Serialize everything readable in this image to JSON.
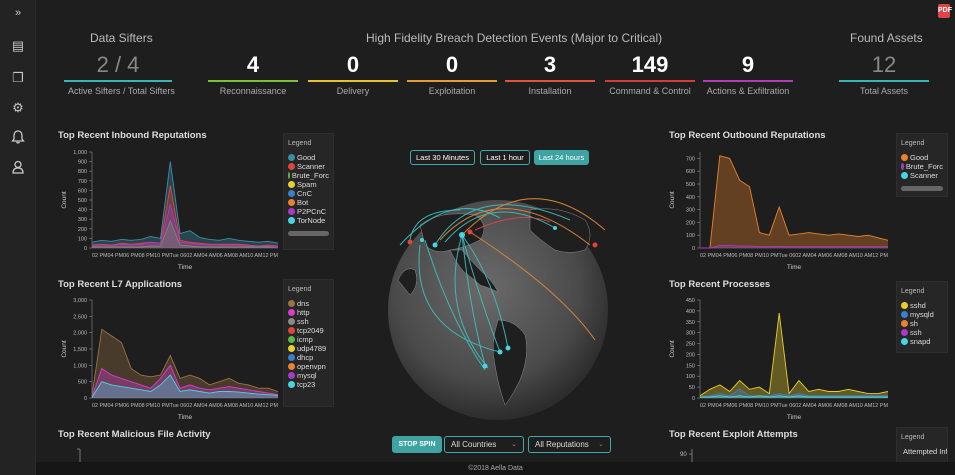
{
  "sidebar": {
    "items": [
      {
        "icon": "expand-chevrons-icon",
        "glyph": "»"
      },
      {
        "icon": "dashboard-card-icon",
        "glyph": "▤"
      },
      {
        "icon": "documents-icon",
        "glyph": "❐"
      },
      {
        "icon": "settings-gears-icon",
        "glyph": "⚙"
      },
      {
        "icon": "bell-icon",
        "glyph": "♫"
      },
      {
        "icon": "user-icon",
        "glyph": "⚇"
      }
    ]
  },
  "header": {
    "data_sifters_title": "Data Sifters",
    "breach_title": "High Fidelity Breach Detection Events (Major to Critical)",
    "found_assets_title": "Found Assets",
    "pdf_label": "PDF"
  },
  "kpis": [
    {
      "value": "2 / 4",
      "label": "Active Sifters / Total Sifters",
      "color": "#3ab5b5"
    },
    {
      "value": "4",
      "label": "Reconnaissance",
      "color": "#7bbf3a"
    },
    {
      "value": "0",
      "label": "Delivery",
      "color": "#e6c232"
    },
    {
      "value": "0",
      "label": "Exploitation",
      "color": "#e89b2e"
    },
    {
      "value": "3",
      "label": "Installation",
      "color": "#e0553a"
    },
    {
      "value": "149",
      "label": "Command & Control",
      "color": "#d43c3c"
    },
    {
      "value": "9",
      "label": "Actions & Exfiltration",
      "color": "#b23cb8"
    },
    {
      "value": "12",
      "label": "Total Assets",
      "color": "#3ab5b5"
    }
  ],
  "panels": {
    "inbound": {
      "title": "Top Recent Inbound Reputations"
    },
    "l7": {
      "title": "Top Recent L7 Applications"
    },
    "malicious": {
      "title": "Top Recent Malicious File Activity"
    },
    "outbound": {
      "title": "Top Recent Outbound Reputations"
    },
    "processes": {
      "title": "Top Recent Processes"
    },
    "exploits": {
      "title": "Top Recent Exploit Attempts"
    }
  },
  "legend_title": "Legend",
  "legends": {
    "inbound": [
      {
        "label": "Good",
        "color": "#3a8fa8"
      },
      {
        "label": "Scanner",
        "color": "#e0453a"
      },
      {
        "label": "Brute_Forc",
        "color": "#5ab84a"
      },
      {
        "label": "Spam",
        "color": "#e8cf2e"
      },
      {
        "label": "CnC",
        "color": "#3a7ed0"
      },
      {
        "label": "Bot",
        "color": "#e8822e"
      },
      {
        "label": "P2PCnC",
        "color": "#a73ac8"
      },
      {
        "label": "TorNode",
        "color": "#46d6e0"
      }
    ],
    "l7": [
      {
        "label": "dns",
        "color": "#9a7344"
      },
      {
        "label": "http",
        "color": "#d83cd0"
      },
      {
        "label": "ssh",
        "color": "#8a8a8a"
      },
      {
        "label": "tcp2049",
        "color": "#e0453a"
      },
      {
        "label": "icmp",
        "color": "#5ab84a"
      },
      {
        "label": "udp4789",
        "color": "#e8cf2e"
      },
      {
        "label": "dhcp",
        "color": "#3a7ed0"
      },
      {
        "label": "openvpn",
        "color": "#e8822e"
      },
      {
        "label": "mysql",
        "color": "#a73ac8"
      },
      {
        "label": "tcp23",
        "color": "#46d6e0"
      }
    ],
    "outbound": [
      {
        "label": "Good",
        "color": "#e8822e"
      },
      {
        "label": "Brute_Forc",
        "color": "#a73ac8"
      },
      {
        "label": "Scanner",
        "color": "#46d6e0"
      }
    ],
    "processes": [
      {
        "label": "sshd",
        "color": "#e8cf2e"
      },
      {
        "label": "mysqld",
        "color": "#3a7ed0"
      },
      {
        "label": "sh",
        "color": "#e8822e"
      },
      {
        "label": "ssh",
        "color": "#a73ac8"
      },
      {
        "label": "snapd",
        "color": "#46d6e0"
      }
    ],
    "exploits": [
      {
        "label": "Attempted Informatior Leak",
        "color": "#a73ac8"
      }
    ]
  },
  "time_buttons": [
    "Last 30 Minutes",
    "Last 1 hour",
    "Last 24 hours"
  ],
  "controls": {
    "stop_spin": "STOP SPIN",
    "countries": "All Countries",
    "reputations": "All Reputations"
  },
  "footer": "©2018 Aella Data",
  "axis": {
    "count": "Count",
    "time": "Time"
  },
  "x_ticks": "02 PM04 PM06 PM08 PM10 PMTue 0602 AM04 AM06 AM08 AM10 AM12 PM",
  "chart_data": [
    {
      "type": "area",
      "title": "Top Recent Inbound Reputations",
      "ylabel": "Count",
      "xlabel": "Time",
      "ylim": [
        0,
        1000
      ],
      "y_ticks": [
        "1,000",
        "900",
        "800",
        "700",
        "600",
        "500",
        "400",
        "300",
        "200",
        "100",
        "0"
      ],
      "series": [
        {
          "name": "Good",
          "values": [
            60,
            80,
            70,
            90,
            80,
            90,
            120,
            100,
            900,
            150,
            180,
            110,
            90,
            80,
            100,
            80,
            70,
            60,
            70,
            50
          ]
        },
        {
          "name": "Scanner",
          "values": [
            30,
            40,
            30,
            50,
            40,
            50,
            60,
            50,
            650,
            80,
            60,
            50,
            40,
            40,
            40,
            40,
            30,
            20,
            30,
            20
          ]
        },
        {
          "name": "Brute_Forc",
          "values": [
            10,
            10,
            10,
            10,
            10,
            10,
            20,
            20,
            280,
            30,
            20,
            10,
            10,
            10,
            10,
            10,
            10,
            10,
            10,
            10
          ]
        },
        {
          "name": "P2PCnC",
          "values": [
            20,
            30,
            20,
            40,
            30,
            40,
            60,
            50,
            450,
            60,
            50,
            40,
            30,
            30,
            30,
            30,
            20,
            20,
            20,
            10
          ]
        }
      ]
    },
    {
      "type": "area",
      "title": "Top Recent L7 Applications",
      "ylabel": "Count",
      "xlabel": "Time",
      "ylim": [
        0,
        3000
      ],
      "y_ticks": [
        "3,000",
        "2,500",
        "2,000",
        "1,500",
        "1,000",
        "500",
        "0"
      ],
      "series": [
        {
          "name": "dns",
          "values": [
            80,
            2100,
            1900,
            1700,
            900,
            700,
            650,
            700,
            1300,
            600,
            700,
            600,
            400,
            500,
            600,
            450,
            400,
            300,
            300,
            200
          ]
        },
        {
          "name": "http",
          "values": [
            40,
            900,
            700,
            600,
            500,
            400,
            300,
            600,
            1000,
            300,
            400,
            300,
            250,
            300,
            350,
            300,
            250,
            200,
            150,
            100
          ]
        },
        {
          "name": "tcp23",
          "values": [
            20,
            500,
            400,
            350,
            300,
            250,
            200,
            400,
            700,
            200,
            250,
            200,
            150,
            200,
            200,
            180,
            150,
            120,
            100,
            80
          ]
        }
      ]
    },
    {
      "type": "area",
      "title": "Top Recent Outbound Reputations",
      "ylabel": "Count",
      "xlabel": "Time",
      "ylim": [
        0,
        750
      ],
      "y_ticks": [
        "700",
        "600",
        "500",
        "400",
        "300",
        "200",
        "100",
        "0"
      ],
      "series": [
        {
          "name": "Good",
          "values": [
            0,
            0,
            720,
            700,
            530,
            480,
            120,
            100,
            320,
            100,
            110,
            120,
            110,
            100,
            110,
            100,
            90,
            100,
            80,
            60
          ]
        },
        {
          "name": "Brute_Forc",
          "values": [
            0,
            0,
            20,
            20,
            15,
            15,
            10,
            10,
            12,
            10,
            10,
            10,
            10,
            10,
            10,
            10,
            10,
            10,
            10,
            10
          ]
        }
      ]
    },
    {
      "type": "area",
      "title": "Top Recent Processes",
      "ylabel": "Count",
      "xlabel": "Time",
      "ylim": [
        0,
        450
      ],
      "y_ticks": [
        "450",
        "400",
        "350",
        "300",
        "250",
        "200",
        "150",
        "100",
        "50",
        "0"
      ],
      "series": [
        {
          "name": "sshd",
          "values": [
            10,
            40,
            60,
            30,
            80,
            40,
            50,
            20,
            390,
            20,
            80,
            30,
            40,
            30,
            30,
            40,
            30,
            20,
            20,
            30
          ]
        },
        {
          "name": "mysqld",
          "values": [
            5,
            10,
            20,
            10,
            40,
            10,
            10,
            10,
            20,
            10,
            20,
            10,
            10,
            10,
            10,
            10,
            10,
            10,
            10,
            10
          ]
        },
        {
          "name": "snapd",
          "values": [
            5,
            5,
            10,
            5,
            10,
            5,
            10,
            5,
            10,
            5,
            10,
            5,
            5,
            5,
            5,
            5,
            5,
            5,
            5,
            5
          ]
        }
      ]
    }
  ]
}
